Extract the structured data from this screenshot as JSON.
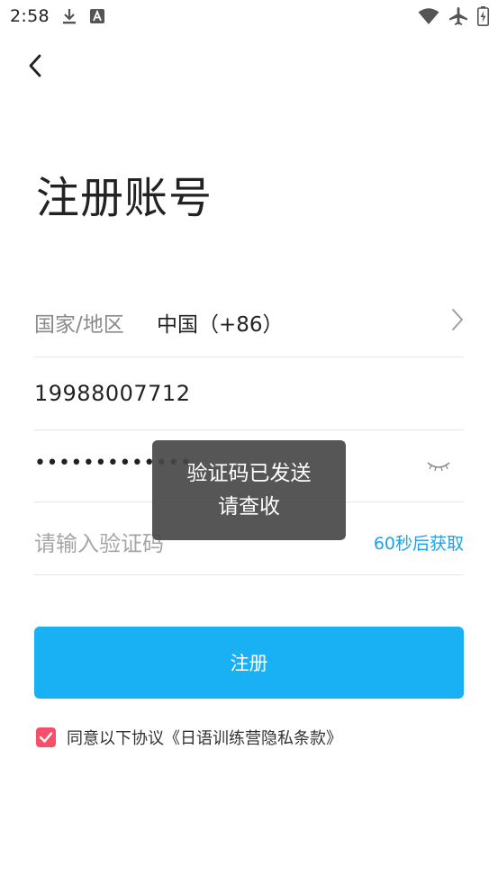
{
  "status_bar": {
    "time": "2:58",
    "left_icons": [
      "download-icon",
      "text-a-icon"
    ],
    "right_icons": [
      "wifi-icon",
      "airplane-icon",
      "battery-charging-icon"
    ]
  },
  "header": {
    "back_icon": "chevron-left-icon"
  },
  "page": {
    "title": "注册账号"
  },
  "form": {
    "region": {
      "label": "国家/地区",
      "value": "中国（+86）",
      "icon": "chevron-right-icon"
    },
    "phone": {
      "value": "19988007712"
    },
    "password": {
      "value": "•••••••••••••",
      "toggle_icon": "eye-closed-icon"
    },
    "code": {
      "placeholder": "请输入验证码",
      "resend_label": "60秒后获取"
    }
  },
  "register_button": {
    "label": "注册"
  },
  "agreement": {
    "checked": true,
    "text": "同意以下协议《日语训练营隐私条款》"
  },
  "toast": {
    "line1": "验证码已发送",
    "line2": "请查收"
  },
  "colors": {
    "accent": "#1ab0f4",
    "link": "#1aa3e8",
    "checkbox": "#f4506a",
    "toast_bg": "#484848"
  }
}
